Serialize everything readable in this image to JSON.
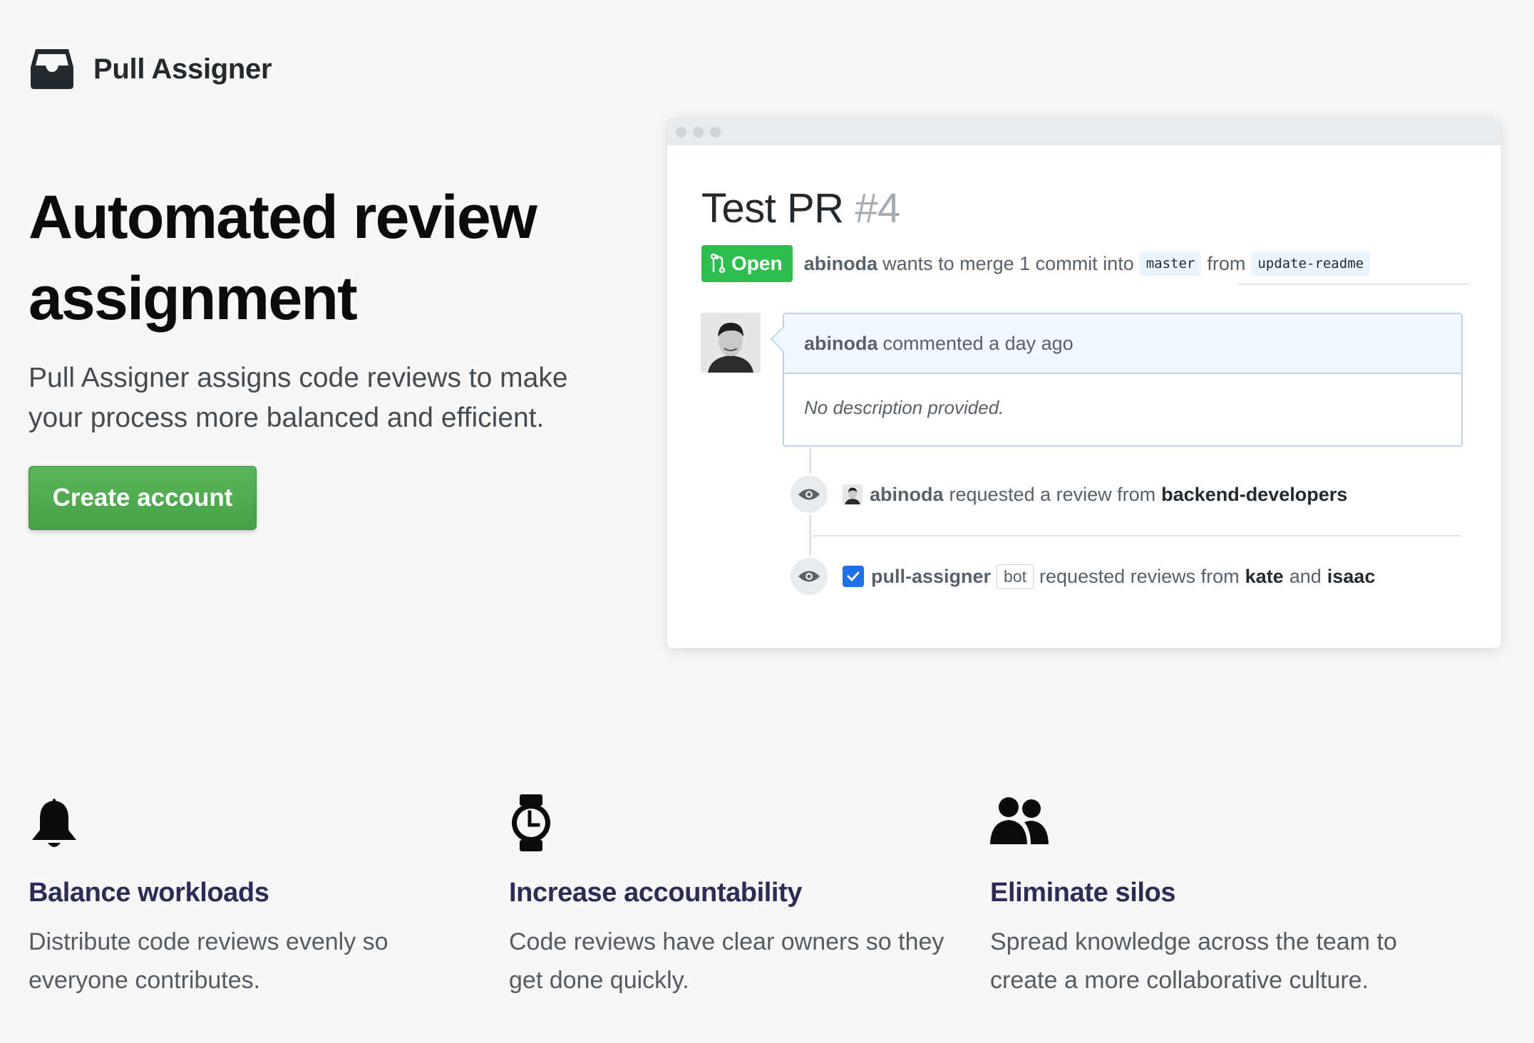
{
  "brand": {
    "name": "Pull Assigner",
    "logo_icon": "inbox-tray-icon"
  },
  "hero": {
    "title": "Automated review assignment",
    "subtitle": "Pull Assigner assigns code reviews to make your process more balanced and efficient.",
    "cta_label": "Create account"
  },
  "mockup": {
    "pr_title": "Test PR",
    "pr_number": "#4",
    "state_label": "Open",
    "meta": {
      "author": "abinoda",
      "text_merge": "wants to merge 1 commit into",
      "base_branch": "master",
      "text_from": "from",
      "head_branch": "update-readme"
    },
    "comment": {
      "author": "abinoda",
      "action": "commented a day ago",
      "body": "No description provided."
    },
    "events": [
      {
        "icon": "eye-icon",
        "actor": "abinoda",
        "text": "requested a review from",
        "target": "backend-developers"
      },
      {
        "icon": "eye-icon",
        "actor": "pull-assigner",
        "badge": "bot",
        "text": "requested reviews from",
        "target1": "kate",
        "conjunction": "and",
        "target2": "isaac"
      }
    ]
  },
  "features": [
    {
      "icon": "bell-icon",
      "title": "Balance workloads",
      "text": "Distribute code reviews evenly so everyone contributes."
    },
    {
      "icon": "watch-icon",
      "title": "Increase accountability",
      "text": "Code reviews have clear owners so they get done quickly."
    },
    {
      "icon": "people-icon",
      "title": "Eliminate silos",
      "text": "Spread knowledge across the team to create a more collaborative culture."
    }
  ],
  "colors": {
    "accent_green": "#4cae4c",
    "badge_green": "#2cbe4e",
    "feature_title": "#2c2c56",
    "page_bg": "#f6f7f6"
  }
}
